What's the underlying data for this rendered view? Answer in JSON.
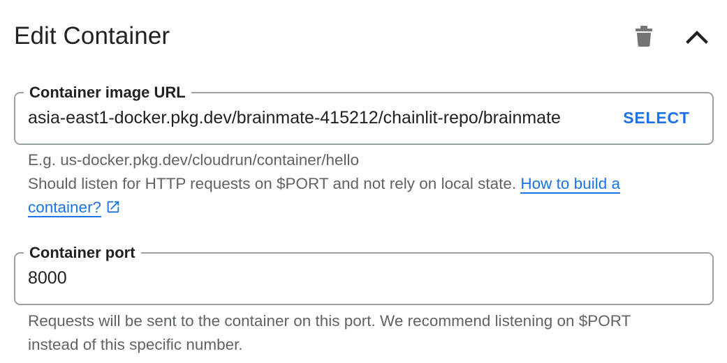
{
  "header": {
    "title": "Edit Container",
    "delete_icon": "trash-icon",
    "collapse_icon": "chevron-up-icon"
  },
  "image_url_field": {
    "label": "Container image URL",
    "value": "asia-east1-docker.pkg.dev/brainmate-415212/chainlit-repo/brainmate",
    "select_label": "SELECT",
    "hint_example": "E.g. us-docker.pkg.dev/cloudrun/container/hello",
    "hint_text": "Should listen for HTTP requests on $PORT and not rely on local state.",
    "help_link_text": "How to build a container?",
    "help_link_icon": "external-link-icon"
  },
  "port_field": {
    "label": "Container port",
    "value": "8000",
    "hint_text": "Requests will be sent to the container on this port. We recommend listening on $PORT instead of this specific number."
  },
  "colors": {
    "accent": "#1a73e8",
    "text": "#202124",
    "secondary_text": "#5f6368",
    "border": "#9aa0a6",
    "icon": "#757575"
  }
}
